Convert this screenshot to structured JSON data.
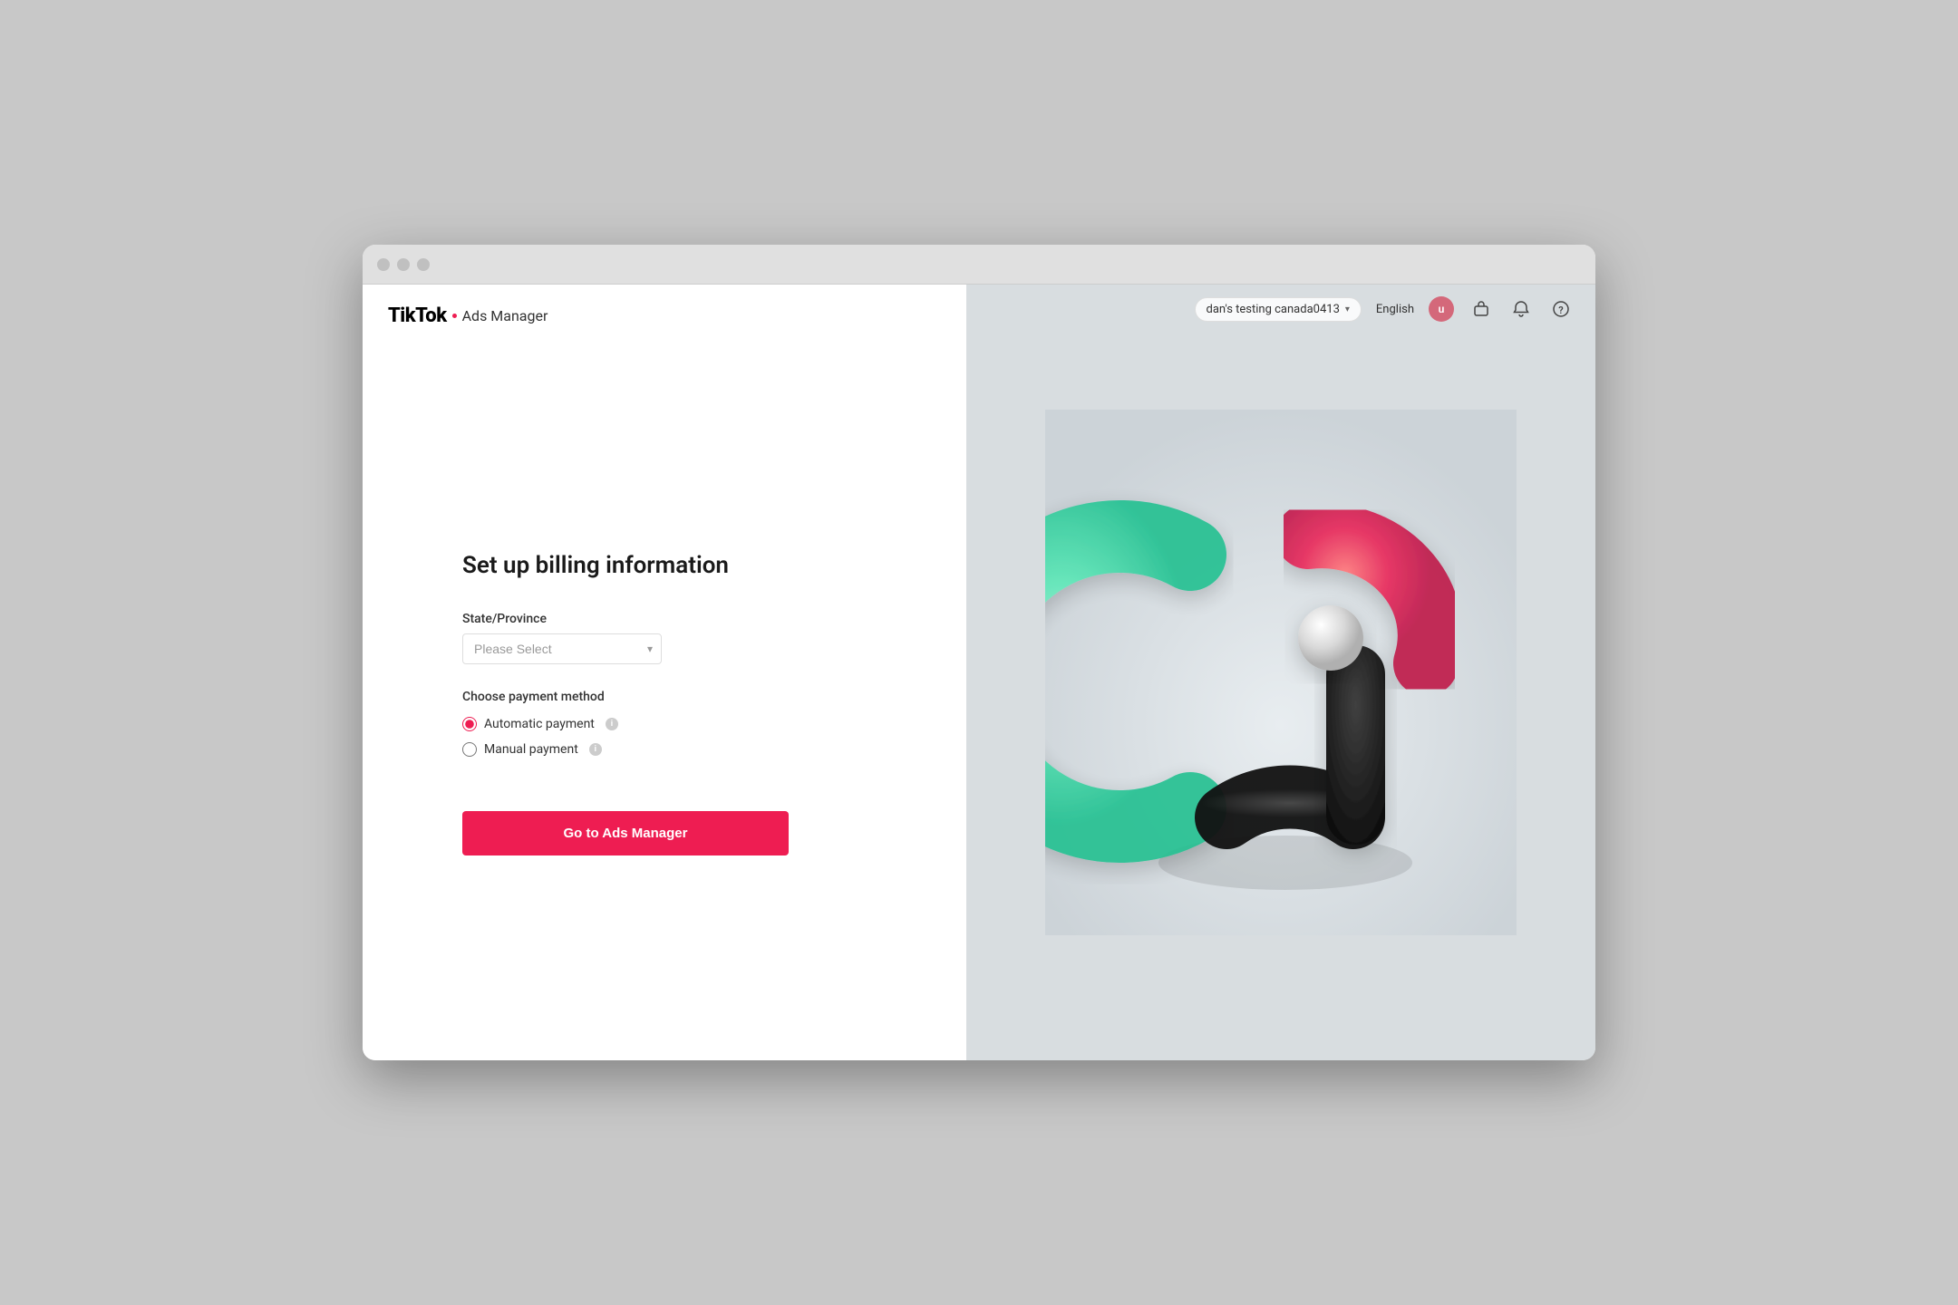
{
  "window": {
    "title": "TikTok Ads Manager"
  },
  "header": {
    "logo_tiktok": "TikTok",
    "logo_separator": ":",
    "logo_ads": "Ads Manager"
  },
  "nav": {
    "account_name": "dan's testing canada0413",
    "language": "English",
    "avatar_initial": "u"
  },
  "form": {
    "title": "Set up billing information",
    "state_label": "State/Province",
    "state_placeholder": "Please Select",
    "payment_label": "Choose payment method",
    "payment_options": [
      {
        "id": "automatic",
        "label": "Automatic payment",
        "checked": true
      },
      {
        "id": "manual",
        "label": "Manual payment",
        "checked": false
      }
    ],
    "submit_button": "Go to Ads Manager"
  },
  "icons": {
    "chevron_down": "▾",
    "info": "i",
    "briefcase": "💼",
    "bell": "🔔",
    "help": "?"
  }
}
